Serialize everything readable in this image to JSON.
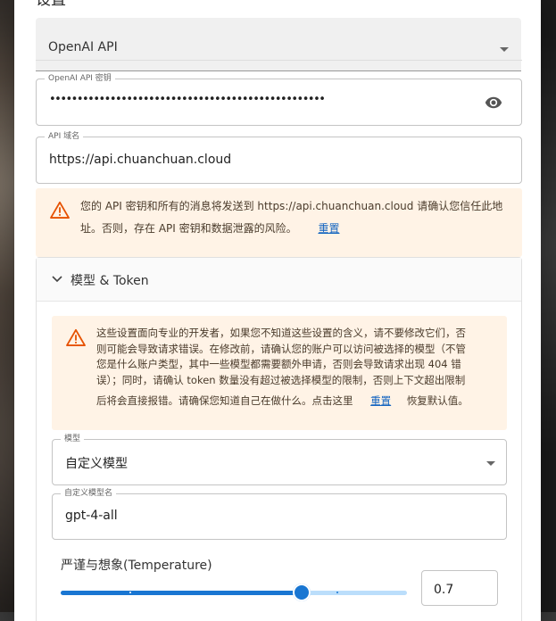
{
  "dialog": {
    "title": "设置"
  },
  "provider": {
    "value": "OpenAI API"
  },
  "api_key": {
    "legend": "OpenAI API 密钥",
    "value": "••••••••••••••••••••••••••••••••••••••••••••••••••"
  },
  "api_domain": {
    "legend": "API 域名",
    "value": "https://api.chuanchuan.cloud"
  },
  "domain_warning": {
    "text_line1": "您的 API 密钥和所有的消息将发送到 https://api.chuanchuan.cloud 请确认您信任此地",
    "text_line2": "址。否则，存在 API 密钥和数据泄露的风险。",
    "reset_label": "重置"
  },
  "model_section": {
    "title": "模型 & Token",
    "warning": {
      "line1": "这些设置面向专业的开发者，如果您不知道这些设置的含义，请不要修改它们，否",
      "line2": "则可能会导致请求错误。在修改前，请确认您的账户可以访问被选择的模型（不管",
      "line3": "您是什么账户类型，其中一些模型都需要额外申请，否则会导致请求出现 404 错",
      "line4": "误）；同时，请确认 token 数量没有超过被选择模型的限制，否则上下文超出限制",
      "line5": "后将会直接报错。请确保您知道自己在做什么。点击这里",
      "reset_label": "重置",
      "suffix": "恢复默认值。"
    },
    "model_select": {
      "legend": "模型",
      "value": "自定义模型"
    },
    "custom_model": {
      "legend": "自定义模型名",
      "value": "gpt-4-all"
    },
    "temperature": {
      "label": "严谨与想象(Temperature)",
      "value": "0.7",
      "fraction": 0.7
    }
  },
  "colors": {
    "accent": "#1976d2",
    "warning_bg": "#fff3e6",
    "warning_icon": "#e65100"
  }
}
